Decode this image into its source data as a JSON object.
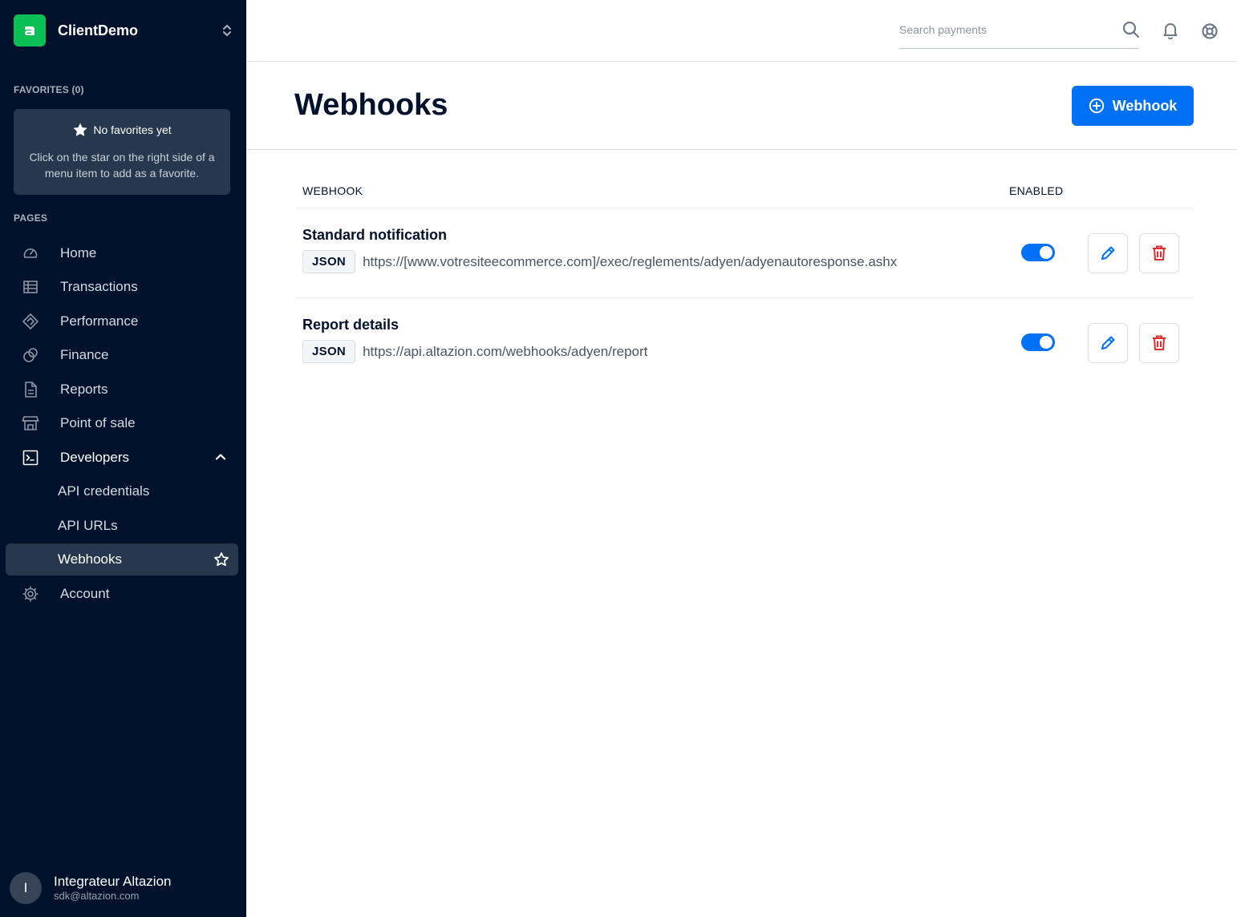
{
  "sidebar": {
    "account_name": "ClientDemo",
    "favorites_label": "FAVORITES (0)",
    "favorites_empty_title": "No favorites yet",
    "favorites_empty_desc": "Click on the star on the right side of a menu item to add as a favorite.",
    "pages_label": "PAGES",
    "items": [
      {
        "label": "Home",
        "icon": "home-gauge-icon"
      },
      {
        "label": "Transactions",
        "icon": "table-icon"
      },
      {
        "label": "Performance",
        "icon": "performance-icon"
      },
      {
        "label": "Finance",
        "icon": "finance-icon"
      },
      {
        "label": "Reports",
        "icon": "document-icon"
      },
      {
        "label": "Point of sale",
        "icon": "store-icon"
      },
      {
        "label": "Developers",
        "icon": "terminal-icon",
        "expanded": true
      },
      {
        "label": "Account",
        "icon": "gear-icon"
      }
    ],
    "developers_sub": [
      {
        "label": "API credentials"
      },
      {
        "label": "API URLs"
      },
      {
        "label": "Webhooks",
        "active": true
      }
    ],
    "user": {
      "initial": "I",
      "name": "Integrateur Altazion",
      "email": "sdk@altazion.com"
    }
  },
  "topbar": {
    "search_placeholder": "Search payments"
  },
  "header": {
    "title": "Webhooks",
    "add_button_label": "Webhook"
  },
  "table": {
    "columns": [
      "WEBHOOK",
      "ENABLED"
    ],
    "rows": [
      {
        "name": "Standard notification",
        "format": "JSON",
        "url": "https://[www.votresiteecommerce.com]/exec/reglements/adyen/adyenautoresponse.ashx",
        "enabled": true
      },
      {
        "name": "Report details",
        "format": "JSON",
        "url": "https://api.altazion.com/webhooks/adyen/report",
        "enabled": true
      }
    ]
  },
  "colors": {
    "sidebar_bg": "#00112c",
    "accent": "#0070f5",
    "brand_green": "#0abf53",
    "danger": "#e22d2d"
  }
}
